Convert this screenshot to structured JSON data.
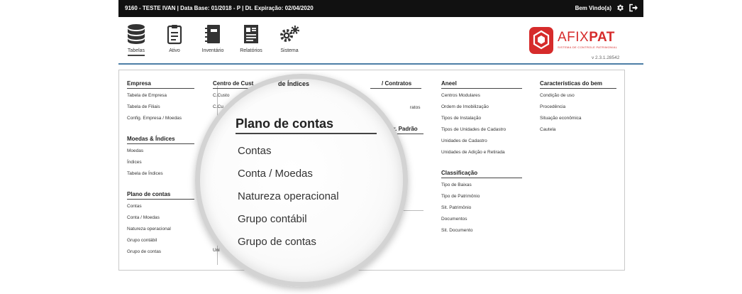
{
  "topbar": {
    "info": "9160 - TESTE IVAN | Data Base: 01/2018 - P | Dt. Expiração: 02/04/2020",
    "welcome": "Bem Vindo(a)"
  },
  "nav": {
    "items": [
      {
        "label": "Tabelas",
        "icon": "database-icon"
      },
      {
        "label": "Ativo",
        "icon": "clipboard-icon"
      },
      {
        "label": "Inventário",
        "icon": "notebook-icon"
      },
      {
        "label": "Relatórios",
        "icon": "report-icon"
      },
      {
        "label": "Sistema",
        "icon": "gears-icon"
      }
    ]
  },
  "logo": {
    "name_light": "AFIX",
    "name_bold": "PAT",
    "subtitle": "SISTEMA DE CONTROLE PATRIMONIAL",
    "version": "v 2.3.1.28542",
    "color": "#d62b2b"
  },
  "menu": {
    "col1": {
      "empresa": {
        "title": "Empresa",
        "items": [
          "Tabela de Empresa",
          "Tabela de Filiais",
          "Config. Empresa / Moedas"
        ]
      },
      "moedas": {
        "title": "Moedas & Índices",
        "items": [
          "Moedas",
          "Índices",
          "Tabela de Índices"
        ]
      },
      "plano": {
        "title": "Plano de contas",
        "items": [
          "Contas",
          "Conta / Moedas",
          "Natureza operacional",
          "Grupo contábil",
          "Grupo de contas"
        ]
      }
    },
    "col2": {
      "title_partial": "Centro de Cust",
      "items_partial": [
        "C.Custo",
        "C.Cu"
      ],
      "bottom_partial": "Uni"
    },
    "col3": {
      "title_partial": "/ Contratos",
      "item_partial": "ratos",
      "title2_partial": "cr. Padrão"
    },
    "col4": {
      "aneel": {
        "title": "Aneel",
        "items": [
          "Centros Modulares",
          "Ordem de Imobilização",
          "Tipos de Instalação",
          "Tipos de Unidades de Cadastro",
          "Unidades de Cadastro",
          "Unidades de Adição e Retirada"
        ]
      },
      "classificacao": {
        "title": "Classificação",
        "items": [
          "Tipo de Baixas",
          "Tipo de Patrimônio",
          "Sit. Patrimônio",
          "Documentos",
          "Sit. Documento"
        ]
      }
    },
    "col5": {
      "caracteristicas": {
        "title": "Características do bem",
        "items": [
          "Condição de uso",
          "Procedência",
          "Situação econômica",
          "Cautela"
        ]
      }
    }
  },
  "magnifier": {
    "fragment": "de Índices",
    "title": "Plano de contas",
    "items": [
      "Contas",
      "Conta / Moedas",
      "Natureza operacional",
      "Grupo contábil",
      "Grupo de contas"
    ]
  }
}
